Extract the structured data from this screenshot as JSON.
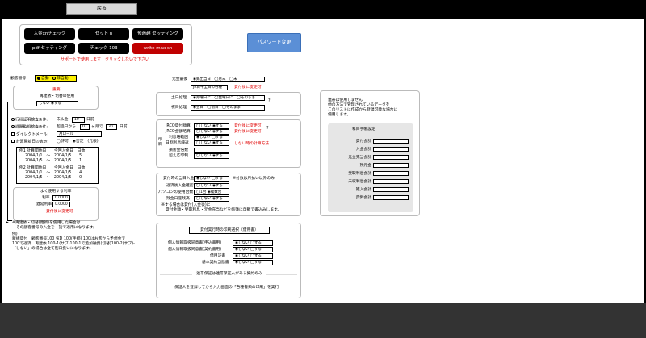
{
  "top": {
    "back_label": "戻る"
  },
  "toolbar": {
    "b1": "入金xnチェック",
    "b2": "セット n",
    "b3": "預逓越 セッティング",
    "b4": "pdf セッティング",
    "b5": "チェック 103",
    "b6": "write max sn",
    "support_note": "サポートで使用します　クリックしないで下さい",
    "password_label": "パスワード変更"
  },
  "customer": {
    "label": "顧客番号",
    "auto": "自動",
    "manual": "非自動",
    "section_title": "重要",
    "reissue_label": "再建依・切替の使用",
    "reissue_value": "しない ◉する"
  },
  "settings": {
    "row1_label": "行程証明検査条件:",
    "row1_mid": "未払金",
    "row1_val": "10",
    "row1_unit": "日前",
    "row2_label": "課題監視検査条件:",
    "row2_mid": "超過日から",
    "row2_v1": "0",
    "row2_unit1": "ヶ月で",
    "row2_v2": "30",
    "row2_unit2": "日前",
    "row3_label": "ダイレクトメール:",
    "row3_val": "月ロール",
    "row4_label": "計算開始日の表示:",
    "row4_val": "◯許可　◉否定　(元帳)",
    "ex1_title": "例1  計算開始日　　今回入金日　日数",
    "ex1_l1": "2004/1/1　～　2004/1/5　　5",
    "ex1_l2": "2004/1/5　～　2004/1/5　　1",
    "ex2_title": "例2  計算開始日　　今回入金日　日数",
    "ex2_l1": "2004/1/1　～　2004/1/5　　4",
    "ex2_l2": "2004/1/5　～　2004/1/5　　0"
  },
  "rates": {
    "title": "よく使用する利率",
    "rate_label": "利率",
    "rate_val": "0.0000",
    "late_label": "遅延利率",
    "late_val": "0.0000",
    "note": "貸付後に変更可"
  },
  "notes": {
    "n1": "※再建依・切替(更新)を使用した場合は",
    "n2": "　その顧客番号の入金を一括で適用になります。",
    "n3": "例)",
    "n4": "新規貸付　顧客番号100 気D 100(手続) 100はお客から予想金で",
    "n5": "100で返済　再建依 100-1(サブ)100-1で追加融資(切替)100-2(サブ)-",
    "n6": "「しない」の場合は全て別口扱いになります。"
  },
  "mid": {
    "calc_label": "元金最後",
    "calc_val": "◉算出当日　◯月末　◯末",
    "calc_sub": "JR日干全日の各種",
    "calc_note": "貸付後に変更可",
    "sat_label": "土日処理",
    "sat_val": "◉月曜日に　◯金曜日に　◯そのまま",
    "hol_label": "祝日処理",
    "hol_val": "◉翌日　◯前日　◯そのまま",
    "r1_label": "JRCO貸付額算",
    "r1_val": "◯しない ◉する",
    "r2_label": "JRCO金額略算",
    "r2_val": "◯しない ◉する",
    "r3_label": "利息略範囲",
    "r3_val": "◉しない ◯する",
    "r4_label": "日割利息繰返",
    "r4_val": "◯しない ◉する",
    "r5_label": "損害金倍数",
    "r5_val": "",
    "r6_label": "超え応印制",
    "r6_val": "◯しない ◉する",
    "side_tag": "印刷",
    "note1": "貸付後に変更可",
    "note2": "貸付後に変更可",
    "note3": "しない時の計算方法",
    "s1_label": "貸付時の当日入金",
    "s1_val": "◉しない ◯する",
    "s1_note": "※付数は月払い以外のみ",
    "s2_label": "返済後入金確認",
    "s2_val": "◯しない ◉する",
    "s3_label": "パソコンの使用台数",
    "s3_val": "◯1台 ◉複数台",
    "s4_label": "残金口座残高",
    "s4_val": "◯しない ◉する",
    "s_note1": "※する場合は貸付(入金後)に",
    "s_note2": "　貸付金額・受取利息・元金充当などを帳簿に自動で書込みします。",
    "cert_title": "貸付実行時の印刷選択（借用書）",
    "c1_label": "個人情報取扱同意書(申込書用)",
    "c1_val": "◉しない ◯する",
    "c2_label": "個人情報取扱同意書(契約書用)",
    "c2_val": "◉しない ◯する",
    "c3_label": "借用証書",
    "c3_val": "◉しない ◯する",
    "c4_label": "基本契約当話書",
    "c4_val": "◉しない ◯する",
    "guar_title": "連帯保証は連帯保証人がある契約のみ",
    "guar_note": "保証人を登録してから入力画面の「各種書類の印刷」を実行"
  },
  "right": {
    "warn1": "連帯は使用しません",
    "warn2": "他の方法で管理されているデータを",
    "warn3": "このリストに作成から登録可能な場合に",
    "warn4": "使用します。",
    "panel_title": "科目手帳設定",
    "items": [
      "貸付会計",
      "入金会計",
      "元金充当会計",
      "残元金",
      "受取利息会計",
      "未収利息会計",
      "雑入会計",
      "貸倒会計"
    ]
  }
}
